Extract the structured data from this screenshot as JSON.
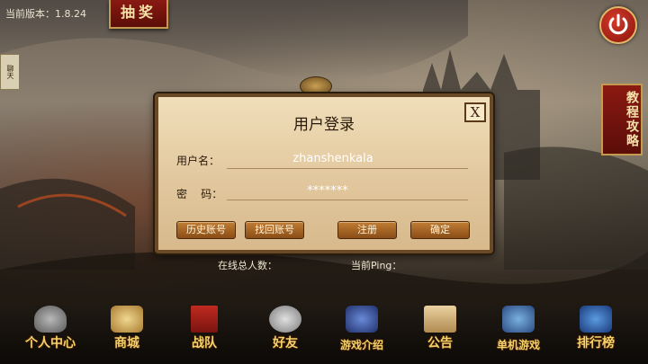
{
  "top": {
    "version": "当前版本：1.8.24",
    "lottery_label": "抽奖",
    "chat_label": "聊天",
    "tutorial_label": "教程攻略"
  },
  "dialog": {
    "title": "用户登录",
    "close_label": "X",
    "username_label": "用户名：",
    "username_value": "zhanshenkala",
    "password_label": "密    码：",
    "password_value": "*******",
    "buttons": {
      "history": "历史账号",
      "recover": "找回账号",
      "register": "注册",
      "confirm": "确定"
    }
  },
  "status": {
    "online_label": "在线总人数：",
    "ping_label": "当前Ping："
  },
  "nav": [
    {
      "label": "个人中心",
      "icon": "helmet-icon",
      "color": "#8a8a8a"
    },
    {
      "label": "商城",
      "icon": "shop-icon",
      "color": "#c9a055"
    },
    {
      "label": "战队",
      "icon": "banner-icon",
      "color": "#a8201a"
    },
    {
      "label": "好友",
      "icon": "friends-icon",
      "color": "#b0b0b0"
    },
    {
      "label": "游戏介绍",
      "icon": "wizard-icon",
      "color": "#3a5aa8"
    },
    {
      "label": "公告",
      "icon": "scroll-icon",
      "color": "#c9a060"
    },
    {
      "label": "单机游戏",
      "icon": "treasure-icon",
      "color": "#3a7ab8"
    },
    {
      "label": "排行榜",
      "icon": "ranking-icon",
      "color": "#2a6ab0"
    }
  ]
}
